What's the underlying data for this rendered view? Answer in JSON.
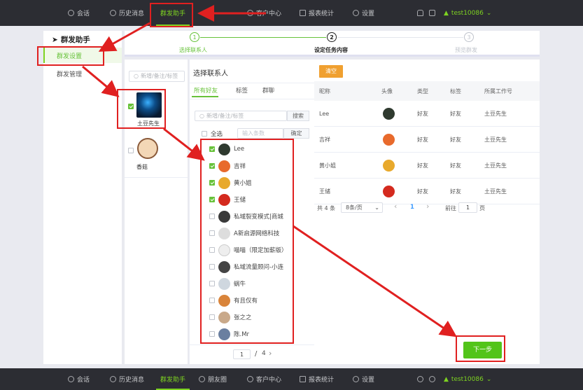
{
  "top_nav": {
    "items": [
      {
        "label": "会话",
        "icon": "chat-icon"
      },
      {
        "label": "历史消息",
        "icon": "clock-icon"
      },
      {
        "label": "群发助手",
        "icon": "",
        "active": true
      },
      {
        "label": "朋友圈",
        "icon": "camera-icon"
      },
      {
        "label": "客户中心",
        "icon": "user-icon"
      },
      {
        "label": "报表统计",
        "icon": "bar-chart-icon"
      },
      {
        "label": "设置",
        "icon": "gear-icon"
      }
    ],
    "username": "test10086"
  },
  "sidebar": {
    "title": "群发助手",
    "items": [
      {
        "label": "群发设置",
        "active": true
      },
      {
        "label": "群发管理",
        "active": false
      }
    ]
  },
  "steps": [
    {
      "num": "1",
      "label": "选择联系人",
      "state": "done"
    },
    {
      "num": "2",
      "label": "设定任务内容",
      "state": "current"
    },
    {
      "num": "3",
      "label": "预览群发",
      "state": "todo"
    }
  ],
  "accounts": {
    "search_placeholder": "新增/备注/标签",
    "items": [
      {
        "name": "土豆先生",
        "checked": true,
        "avatar_color": "#0b2a4a"
      },
      {
        "name": "香菇",
        "checked": false,
        "avatar_color": "#f3d7b6"
      }
    ]
  },
  "contacts": {
    "title": "选择联系人",
    "tabs": [
      "所有好友",
      "标签",
      "群聊"
    ],
    "search_placeholder": "新增/备注/标签",
    "search_button": "搜索",
    "select_all": "全选",
    "count_placeholder": "输入条数",
    "confirm_button": "确定",
    "items": [
      {
        "name": "Lee",
        "checked": true,
        "avatar_color": "#2f3a2f"
      },
      {
        "name": "吉祥",
        "checked": true,
        "avatar_color": "#e86a2c"
      },
      {
        "name": "黄小姐",
        "checked": true,
        "avatar_color": "#e8a92c"
      },
      {
        "name": "王储",
        "checked": true,
        "avatar_color": "#d42a1e"
      },
      {
        "name": "私域裂变模式|商城",
        "checked": false,
        "avatar_color": "#3a3a3a"
      },
      {
        "name": "A新启源网络科技",
        "checked": false,
        "avatar_color": "#dddddd"
      },
      {
        "name": "喵喵（限定加薪版）",
        "checked": false,
        "avatar_color": "#eeeeee"
      },
      {
        "name": "私域流量顾问-小连",
        "checked": false,
        "avatar_color": "#444444"
      },
      {
        "name": "蜗牛",
        "checked": false,
        "avatar_color": "#cfd7df"
      },
      {
        "name": "有且仅有",
        "checked": false,
        "avatar_color": "#d9843a"
      },
      {
        "name": "张之之",
        "checked": false,
        "avatar_color": "#c9a98a"
      },
      {
        "name": "陈.Mr",
        "checked": false,
        "avatar_color": "#6a7fa0"
      }
    ],
    "page_current": "1",
    "page_sep": "/",
    "page_total": "4",
    "page_next": "›"
  },
  "selected": {
    "clear_button": "清空",
    "columns": [
      "昵称",
      "头像",
      "类型",
      "标签",
      "所属工作号"
    ],
    "rows": [
      {
        "name": "Lee",
        "type": "好友",
        "tag": "好友",
        "owner": "土豆先生",
        "avatar_color": "#2f3a2f"
      },
      {
        "name": "吉祥",
        "type": "好友",
        "tag": "好友",
        "owner": "土豆先生",
        "avatar_color": "#e86a2c"
      },
      {
        "name": "黄小姐",
        "type": "好友",
        "tag": "好友",
        "owner": "土豆先生",
        "avatar_color": "#e8a92c"
      },
      {
        "name": "王储",
        "type": "好友",
        "tag": "好友",
        "owner": "土豆先生",
        "avatar_color": "#d42a1e"
      }
    ],
    "total": "共 4 条",
    "page_size": "8条/页",
    "prev": "‹",
    "current_page": "1",
    "next": "›",
    "goto_label": "前往",
    "goto_value": "1",
    "page_unit": "页"
  },
  "next_button": "下一步",
  "colors": {
    "accent": "#7ed321",
    "annotation": "#e02020",
    "orange": "#f0a030"
  }
}
